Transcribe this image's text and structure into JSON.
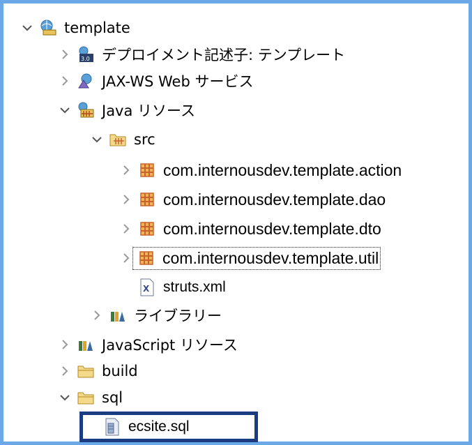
{
  "tree": {
    "items": [
      {
        "label": "template",
        "expanded": true,
        "icon": "web-project-icon"
      },
      {
        "label": "デプロイメント記述子: テンプレート",
        "expanded": false,
        "icon": "deployment-descriptor-icon"
      },
      {
        "label": "JAX-WS Web サービス",
        "expanded": false,
        "icon": "web-services-icon"
      },
      {
        "label": "Java リソース",
        "expanded": true,
        "icon": "java-resources-icon"
      },
      {
        "label": "src",
        "expanded": true,
        "icon": "source-folder-icon"
      },
      {
        "label": "com.internousdev.template.action",
        "expanded": false,
        "icon": "package-icon"
      },
      {
        "label": "com.internousdev.template.dao",
        "expanded": false,
        "icon": "package-icon"
      },
      {
        "label": "com.internousdev.template.dto",
        "expanded": false,
        "icon": "package-icon"
      },
      {
        "label": "com.internousdev.template.util",
        "expanded": false,
        "icon": "package-icon"
      },
      {
        "label": "struts.xml",
        "icon": "xml-file-icon"
      },
      {
        "label": "ライブラリー",
        "expanded": false,
        "icon": "library-icon"
      },
      {
        "label": "JavaScript リソース",
        "expanded": false,
        "icon": "library-icon"
      },
      {
        "label": "build",
        "expanded": false,
        "icon": "folder-icon"
      },
      {
        "label": "sql",
        "expanded": true,
        "icon": "folder-icon"
      },
      {
        "label": "ecsite.sql",
        "icon": "sql-file-icon"
      }
    ]
  },
  "colors": {
    "frame": "#6aa8e8",
    "selection_border": "#1a3d82",
    "arrow": "#9a9a9a",
    "package": "#c8632a",
    "folder": "#e9c45a"
  }
}
